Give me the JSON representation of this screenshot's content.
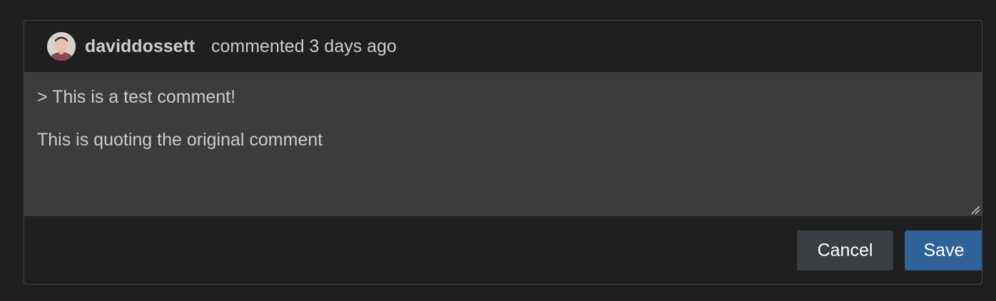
{
  "comment": {
    "author": "daviddossett",
    "meta": "commented 3 days ago",
    "avatar_icon": "user-avatar"
  },
  "editor": {
    "lines": [
      "> This is a test comment!",
      "",
      "This is quoting the original comment"
    ]
  },
  "actions": {
    "cancel_label": "Cancel",
    "save_label": "Save"
  },
  "colors": {
    "background": "#1f1f1f",
    "editor_background": "#3c3c3c",
    "border": "#454545",
    "text": "#cccccc",
    "cancel_button": "#3a3d41",
    "save_button": "#2f6298"
  }
}
